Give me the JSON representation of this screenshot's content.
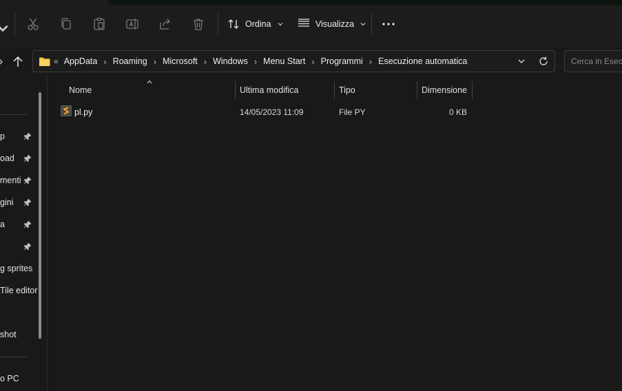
{
  "toolbar": {
    "sort_label": "Ordina",
    "view_label": "Visualizza",
    "icons": [
      "chevron-down-icon",
      "cut-icon",
      "copy-icon",
      "paste-icon",
      "rename-icon",
      "share-icon",
      "delete-icon",
      "sort-icon",
      "view-icon",
      "more-icon"
    ]
  },
  "address": {
    "overflow": "«",
    "crumbs": [
      "AppData",
      "Roaming",
      "Microsoft",
      "Windows",
      "Menu Start",
      "Programmi",
      "Esecuzione automatica"
    ],
    "separator": "›"
  },
  "search": {
    "placeholder": "Cerca in Esecuzione automatica"
  },
  "sidebar": {
    "items": [
      {
        "label": "p",
        "pinned": true
      },
      {
        "label": "oad",
        "pinned": true
      },
      {
        "label": "menti",
        "pinned": true
      },
      {
        "label": "gini",
        "pinned": true
      },
      {
        "label": "a",
        "pinned": true
      },
      {
        "label": "",
        "pinned": true
      },
      {
        "label": "g sprites",
        "pinned": false
      },
      {
        "label": "Tile editor",
        "pinned": false
      },
      {
        "label": "shot",
        "pinned": false
      },
      {
        "label": "o PC",
        "pinned": false
      }
    ]
  },
  "columns": {
    "name": "Nome",
    "modified": "Ultima modifica",
    "type": "Tipo",
    "size": "Dimensione"
  },
  "files": [
    {
      "name": "pl.py",
      "modified": "14/05/2023 11:09",
      "type": "File PY",
      "size": "0 KB"
    }
  ],
  "colors": {
    "background": "#191919",
    "folder": "#f2c443",
    "file_icon": "#f0a020"
  }
}
